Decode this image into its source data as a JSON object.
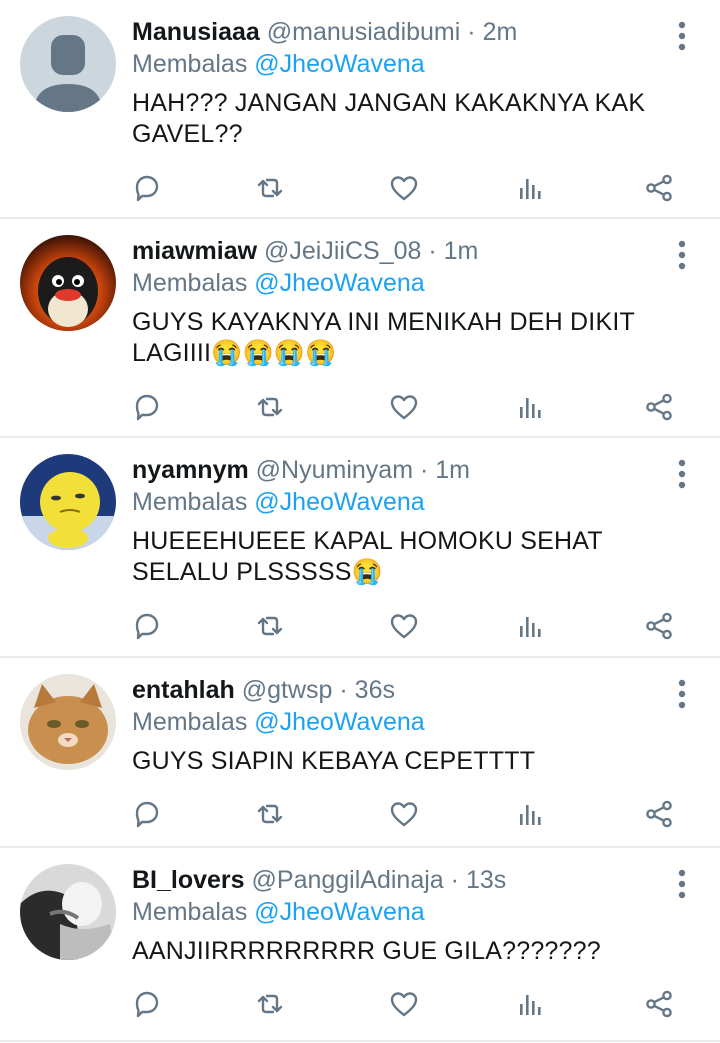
{
  "replying_label": "Membalas",
  "tweets": [
    {
      "name": "Manusiaaa",
      "handle": "@manusiadibumi",
      "time": "2m",
      "reply_to": "@JheoWavena",
      "text": "HAH??? JANGAN JANGAN KAKAKNYA KAK GAVEL??",
      "avatar": "default-person"
    },
    {
      "name": "miawmiaw",
      "handle": "@JeiJiiCS_08",
      "time": "1m",
      "reply_to": "@JheoWavena",
      "text": "GUYS KAYAKNYA INI MENIKAH DEH DIKIT LAGIIII😭😭😭😭",
      "avatar": "penguin-fire"
    },
    {
      "name": "nyamnym",
      "handle": "@Nyuminyam",
      "time": "1m",
      "reply_to": "@JheoWavena",
      "text": "HUEEEHUEEE KAPAL HOMOKU SEHAT SELALU PLSSSSS😭",
      "avatar": "yellow-duck"
    },
    {
      "name": "entahlah",
      "handle": "@gtwsp",
      "time": "36s",
      "reply_to": "@JheoWavena",
      "text": "GUYS SIAPIN KEBAYA CEPETTTT",
      "avatar": "grumpy-cat"
    },
    {
      "name": "BI_lovers",
      "handle": "@PanggilAdinaja",
      "time": "13s",
      "reply_to": "@JheoWavena",
      "text": "AANJIIRRRRRRRRR GUE GILA???????",
      "avatar": "bw-couple"
    }
  ],
  "icons": {
    "reply": "comment-icon",
    "retweet": "retweet-icon",
    "like": "heart-icon",
    "analytics": "analytics-icon",
    "share": "share-icon",
    "more": "more-vertical-icon"
  },
  "colors": {
    "mention": "#1da1f2",
    "secondary_text": "#657786",
    "divider": "#e6ecf0"
  }
}
